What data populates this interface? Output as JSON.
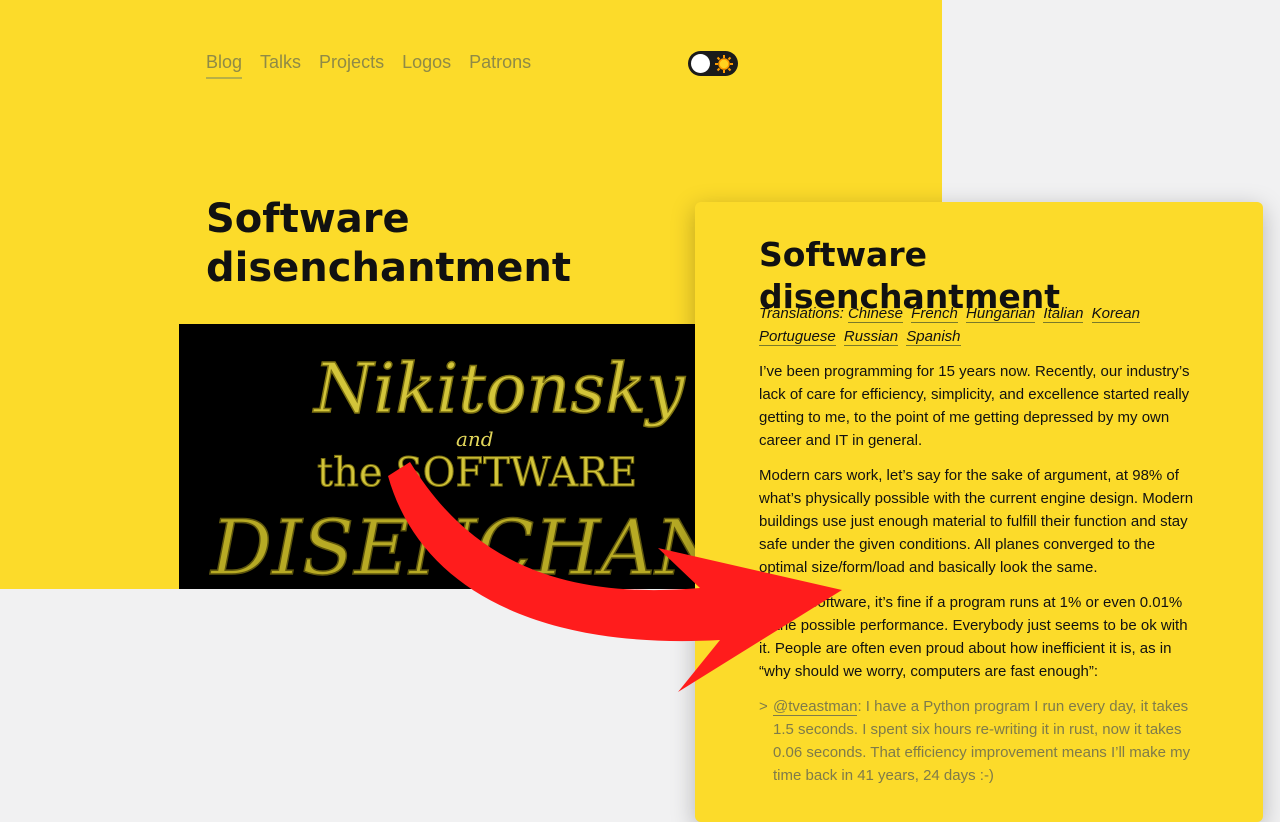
{
  "nav": {
    "items": [
      {
        "label": "Blog",
        "active": true
      },
      {
        "label": "Talks"
      },
      {
        "label": "Projects"
      },
      {
        "label": "Logos"
      },
      {
        "label": "Patrons"
      }
    ],
    "theme_toggle_icon": "sun-icon"
  },
  "hero": {
    "title": "Software disenchantment",
    "image": {
      "line1": "Nikitonsky",
      "line2": "and",
      "line3": "the SOFTWARE",
      "line4": "DISENCHANTMENT"
    }
  },
  "card": {
    "title": "Software disenchantment",
    "translations_label": "Translations:",
    "translations": [
      "Chinese",
      "French",
      "Hungarian",
      "Italian",
      "Korean",
      "Portuguese",
      "Russian",
      "Spanish"
    ],
    "paragraphs": [
      "I’ve been programming for 15 years now. Recently, our industry’s lack of care for efficiency, simplicity, and excellence started really getting to me, to the point of me getting depressed by my own career and IT in general.",
      "Modern cars work, let’s say for the sake of argument, at 98% of what’s physically possible with the current engine design. Modern buildings use just enough material to fulfill their function and stay safe under the given conditions. All planes converged to the optimal size/form/load and basically look the same.",
      "Only in software, it’s fine if a program runs at 1% or even 0.01% of the possible performance. Everybody just seems to be ok with it. People are often even proud about how inefficient it is, as in “why should we worry, computers are fast enough”:"
    ],
    "quote": {
      "marker": ">",
      "author": "@tveastman",
      "text": ": I have a Python program I run every day, it takes 1.5 seconds. I spent six hours re-writing it in rust, now it takes 0.06 seconds. That efficiency improvement means I’ll make my time back in 41 years, 24 days :-)"
    }
  },
  "colors": {
    "accent_yellow": "#fcdb2a",
    "arrow_red": "#ff1c1c",
    "background": "#f1f1f2"
  }
}
